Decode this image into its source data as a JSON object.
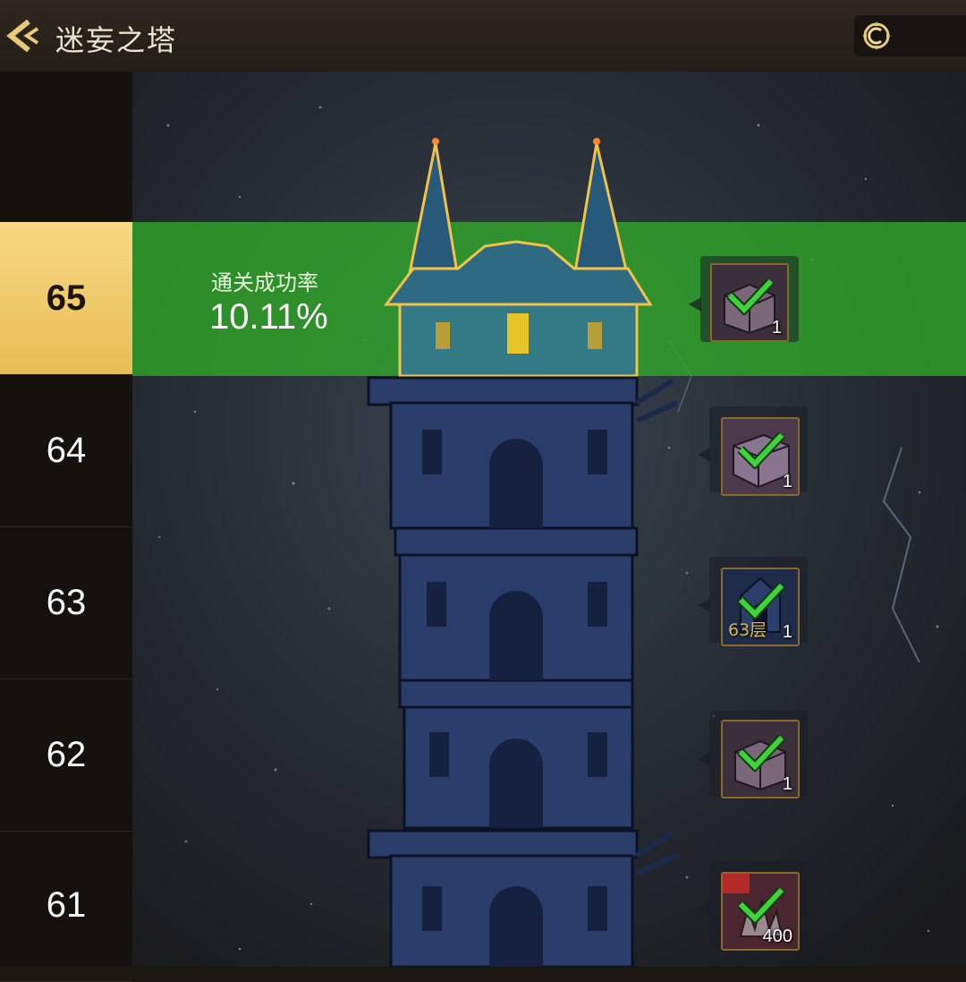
{
  "header": {
    "title": "迷妄之塔",
    "currency_amount": ""
  },
  "sidebar": {
    "floors": [
      {
        "label": "65",
        "active": true
      },
      {
        "label": "64",
        "active": false
      },
      {
        "label": "63",
        "active": false
      },
      {
        "label": "62",
        "active": false
      },
      {
        "label": "61",
        "active": false
      }
    ]
  },
  "current_floor": {
    "clear_rate_label": "通关成功率",
    "clear_rate_value": "10.11%"
  },
  "rewards": [
    {
      "floor": "65",
      "icon": "treasure-chest-icon",
      "count": "1",
      "claimed": true,
      "tag": ""
    },
    {
      "floor": "64",
      "icon": "purple-chest-icon",
      "count": "1",
      "claimed": true,
      "tag": ""
    },
    {
      "floor": "63",
      "icon": "floor-badge-icon",
      "count": "1",
      "claimed": true,
      "tag": "63层"
    },
    {
      "floor": "62",
      "icon": "treasure-chest-icon",
      "count": "1",
      "claimed": true,
      "tag": ""
    },
    {
      "floor": "61",
      "icon": "crystal-shard-icon",
      "count": "400",
      "claimed": true,
      "tag": ""
    }
  ],
  "colors": {
    "active_tab": "#f0c96a",
    "clear_band": "#30a828",
    "check": "#3ed33a",
    "title_text": "#ece3d1"
  }
}
